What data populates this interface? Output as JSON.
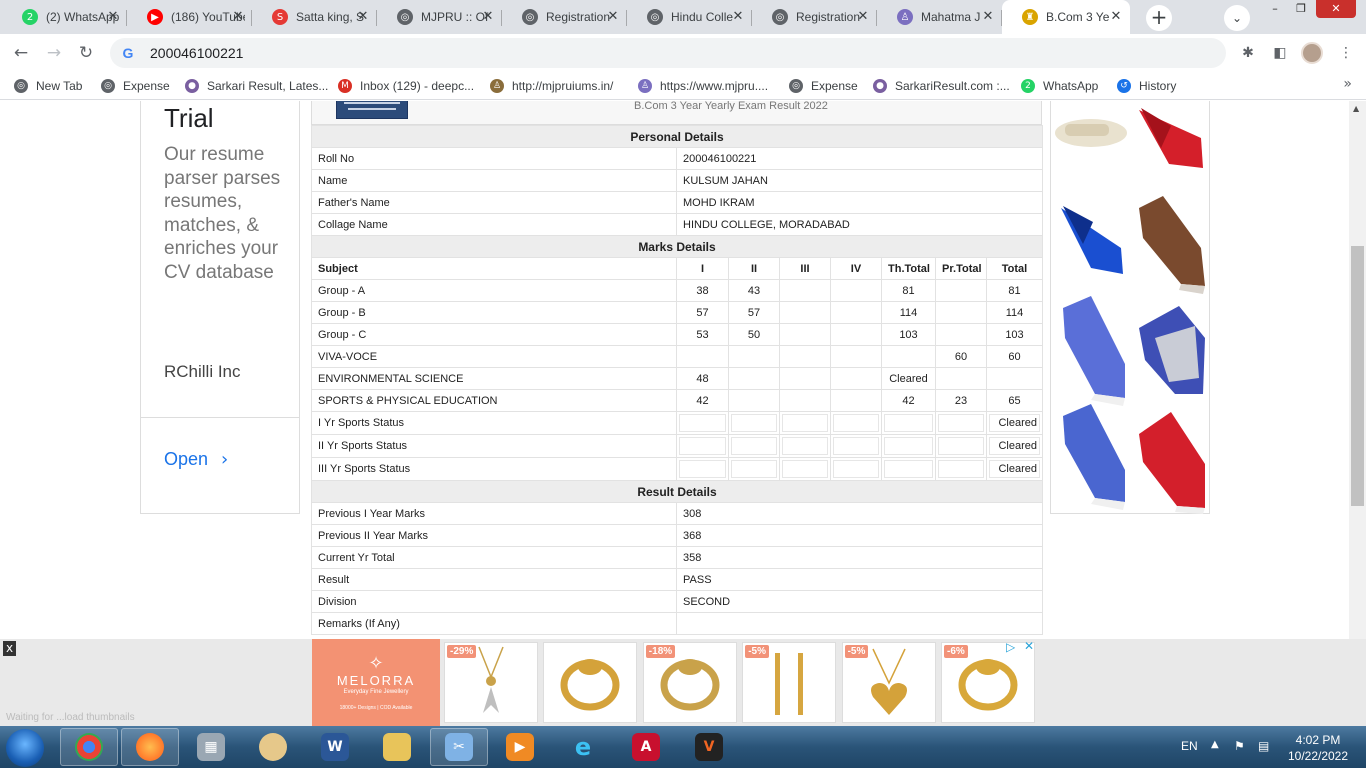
{
  "tabs": [
    {
      "label": "(2) WhatsApp",
      "icon": "whatsapp-icon",
      "color": "#25d366",
      "glyph": "2"
    },
    {
      "label": "(186) YouTube",
      "icon": "youtube-icon",
      "color": "#ff0000",
      "glyph": "▶"
    },
    {
      "label": "Satta king, S",
      "icon": "satta-icon",
      "color": "#e53935",
      "glyph": "S"
    },
    {
      "label": "MJPRU :: Of",
      "icon": "globe-icon",
      "color": "#5f6368",
      "glyph": "◎"
    },
    {
      "label": "Registration",
      "icon": "globe-icon",
      "color": "#5f6368",
      "glyph": "◎"
    },
    {
      "label": "Hindu Colle",
      "icon": "globe-icon",
      "color": "#5f6368",
      "glyph": "◎"
    },
    {
      "label": "Registration",
      "icon": "globe-icon",
      "color": "#5f6368",
      "glyph": "◎"
    },
    {
      "label": "Mahatma J",
      "icon": "mjpru-logo-icon",
      "color": "#7b6fc0",
      "glyph": "♙"
    },
    {
      "label": "B.Com 3 Ye",
      "icon": "result-page-icon",
      "color": "#d9a400",
      "glyph": "♜"
    }
  ],
  "address": {
    "value": "200046100221"
  },
  "bookmarks": [
    {
      "label": "New Tab",
      "icon": "globe-icon",
      "color": "#5f6368",
      "glyph": "◎"
    },
    {
      "label": "Expense",
      "icon": "globe-icon",
      "color": "#5f6368",
      "glyph": "◎"
    },
    {
      "label": "Sarkari Result, Lates...",
      "icon": "sarkari-icon",
      "color": "#7a5fa0",
      "glyph": "●"
    },
    {
      "label": "Inbox (129) - deepc...",
      "icon": "gmail-icon",
      "color": "#d93025",
      "glyph": "M"
    },
    {
      "label": "http://mjpruiums.in/",
      "icon": "mjpru-icon",
      "color": "#8a6d3b",
      "glyph": "♙"
    },
    {
      "label": "https://www.mjpru....",
      "icon": "mjpru-icon",
      "color": "#7b6fc0",
      "glyph": "♙"
    },
    {
      "label": "Expense",
      "icon": "globe-icon",
      "color": "#5f6368",
      "glyph": "◎"
    },
    {
      "label": "SarkariResult.com :...",
      "icon": "sarkari-icon",
      "color": "#7a5fa0",
      "glyph": "●"
    },
    {
      "label": "WhatsApp",
      "icon": "whatsapp-icon",
      "color": "#25d366",
      "glyph": "2"
    },
    {
      "label": "History",
      "icon": "history-icon",
      "color": "#1a73e8",
      "glyph": "↺"
    }
  ],
  "left_ad": {
    "heading": "Trial",
    "description": "Our resume parser parses resumes, matches, & enriches your CV database",
    "brand": "RChilli Inc",
    "cta": "Open"
  },
  "result": {
    "exam_title": "B.Com 3 Year Yearly Exam Result 2022",
    "personal_title": "Personal Details",
    "personal": [
      {
        "label": "Roll No",
        "value": "200046100221"
      },
      {
        "label": "Name",
        "value": "KULSUM JAHAN"
      },
      {
        "label": "Father's Name",
        "value": "MOHD IKRAM"
      },
      {
        "label": "Collage Name",
        "value": "HINDU COLLEGE, MORADABAD"
      }
    ],
    "marks_title": "Marks Details",
    "marks_headers": [
      "Subject",
      "I",
      "II",
      "III",
      "IV",
      "Th.Total",
      "Pr.Total",
      "Total"
    ],
    "marks_rows": [
      [
        "Group - A",
        "38",
        "43",
        "",
        "",
        "81",
        "",
        "81"
      ],
      [
        "Group - B",
        "57",
        "57",
        "",
        "",
        "114",
        "",
        "114"
      ],
      [
        "Group - C",
        "53",
        "50",
        "",
        "",
        "103",
        "",
        "103"
      ],
      [
        "VIVA-VOCE",
        "",
        "",
        "",
        "",
        "",
        "60",
        "60"
      ],
      [
        "ENVIRONMENTAL SCIENCE",
        "48",
        "",
        "",
        "",
        "Cleared",
        "",
        ""
      ],
      [
        "SPORTS & PHYSICAL EDUCATION",
        "42",
        "",
        "",
        "",
        "42",
        "23",
        "65"
      ]
    ],
    "sports_rows": [
      {
        "label": "I Yr Sports Status",
        "status": "Cleared"
      },
      {
        "label": "II Yr Sports Status",
        "status": "Cleared"
      },
      {
        "label": "III Yr Sports Status",
        "status": "Cleared"
      }
    ],
    "result_title": "Result Details",
    "result_rows": [
      {
        "label": "Previous I Year Marks",
        "value": "308"
      },
      {
        "label": "Previous II Year Marks",
        "value": "368"
      },
      {
        "label": "Current Yr Total",
        "value": "358"
      },
      {
        "label": "Result",
        "value": "PASS"
      },
      {
        "label": "Division",
        "value": "SECOND"
      },
      {
        "label": "Remarks (If Any)",
        "value": ""
      }
    ]
  },
  "bottom_ad": {
    "brand": "MELORRA",
    "tagline": "Everyday Fine Jewellery",
    "mini": "18000+ Designs | COD Available",
    "products": [
      {
        "discount": "-29%",
        "icon": "pendant-icon"
      },
      {
        "discount": "",
        "icon": "ring-icon"
      },
      {
        "discount": "-18%",
        "icon": "ring-icon"
      },
      {
        "discount": "-5%",
        "icon": "earrings-icon"
      },
      {
        "discount": "-5%",
        "icon": "heart-pendant-icon"
      },
      {
        "discount": "-6%",
        "icon": "ring-icon"
      }
    ],
    "status_text": "Waiting for ...load thumbnails"
  },
  "taskbar": {
    "language": "EN",
    "time": "4:02 PM",
    "date": "10/22/2022"
  },
  "colors": {
    "accent": "#1a73e8",
    "melorra": "#f39273",
    "taskbar": "#2a5478"
  }
}
